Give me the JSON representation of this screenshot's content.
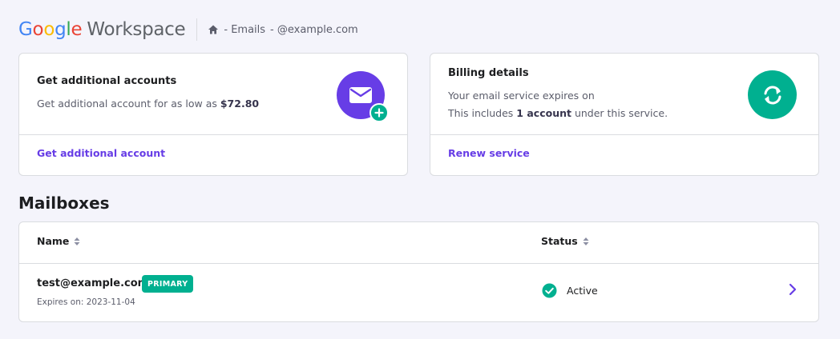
{
  "header": {
    "logo_google": "Google",
    "logo_workspace": "Workspace",
    "breadcrumb_emails": "- Emails",
    "breadcrumb_domain": "- @example.com"
  },
  "accounts_card": {
    "title": "Get additional accounts",
    "text_prefix": "Get additional account for as low as ",
    "price": "$72.80",
    "link": "Get additional account",
    "icon": "mail-plus-icon"
  },
  "billing_card": {
    "title": "Billing details",
    "line1": "Your email service expires on",
    "line2_prefix": "This includes ",
    "line2_bold": "1 account",
    "line2_suffix": " under this service.",
    "link": "Renew service",
    "icon": "renew-icon"
  },
  "mailboxes": {
    "title": "Mailboxes",
    "columns": [
      "Name",
      "Status"
    ],
    "rows": [
      {
        "email": "test@example.com",
        "badge": "PRIMARY",
        "expires": "Expires on: 2023-11-04",
        "status": "Active"
      }
    ]
  },
  "colors": {
    "accent": "#673de6",
    "success": "#00b090",
    "background": "#f4f4fb"
  }
}
